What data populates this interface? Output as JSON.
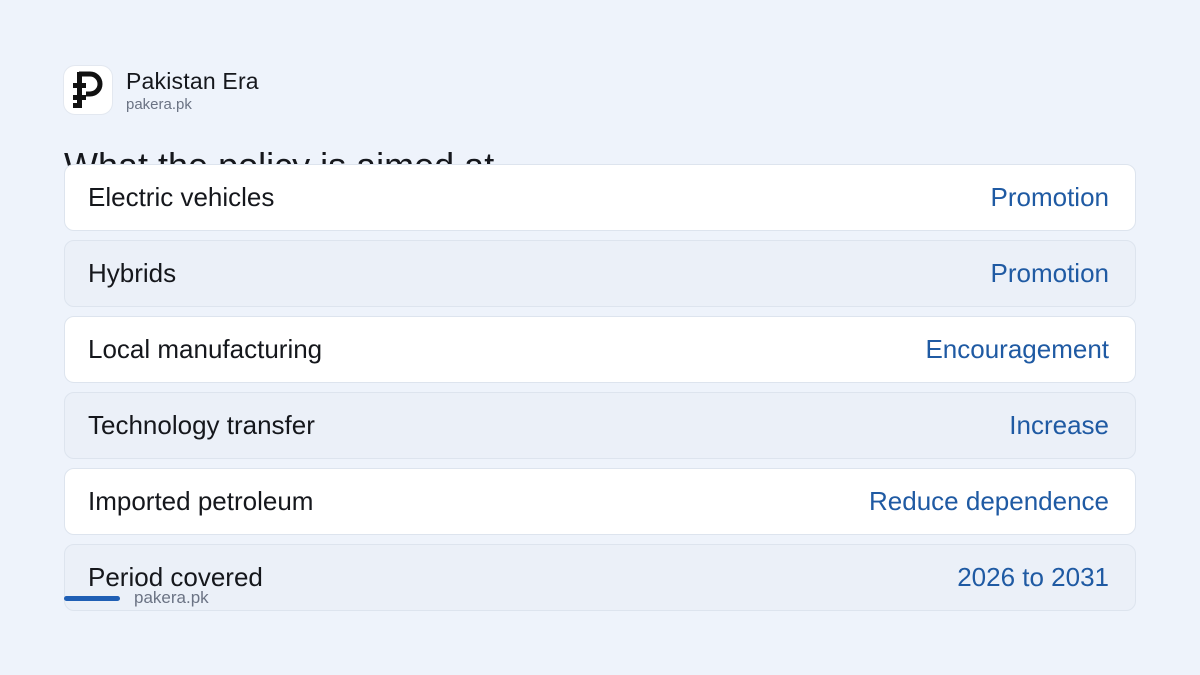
{
  "brand": {
    "name": "Pakistan Era",
    "url": "pakera.pk",
    "logo_icon": "pakistan-era-logo-icon"
  },
  "heading": "What the policy is aimed at",
  "rows": [
    {
      "label": "Electric vehicles",
      "value": "Promotion"
    },
    {
      "label": "Hybrids",
      "value": "Promotion"
    },
    {
      "label": "Local manufacturing",
      "value": "Encouragement"
    },
    {
      "label": "Technology transfer",
      "value": "Increase"
    },
    {
      "label": "Imported petroleum",
      "value": "Reduce dependence"
    },
    {
      "label": "Period covered",
      "value": "2026 to 2031"
    }
  ],
  "footer": {
    "url": "pakera.pk"
  },
  "colors": {
    "background": "#eef3fb",
    "accent": "#1f5fb5",
    "value_text": "#1f5aa3"
  }
}
